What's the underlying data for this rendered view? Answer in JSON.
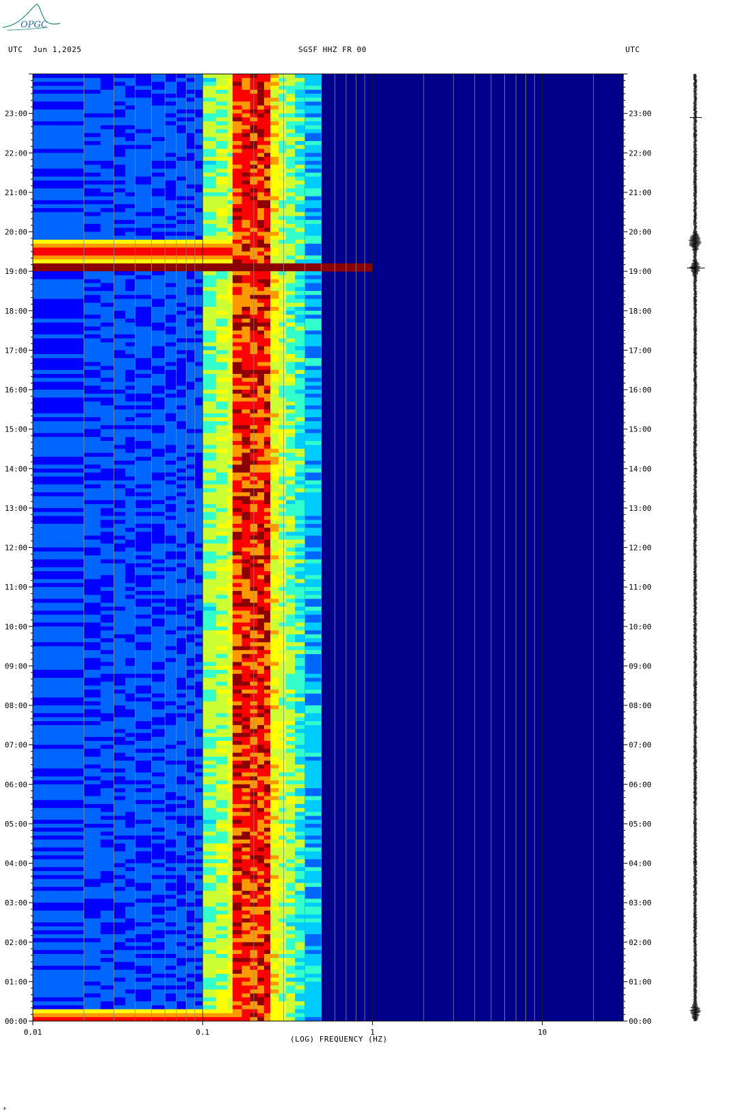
{
  "header": {
    "tz_left": "UTC",
    "date": "Jun 1,2025",
    "station": "SGSF HHZ FR 00",
    "tz_right": "UTC"
  },
  "logo": {
    "text": "OPGC",
    "color": "#1f8f6a"
  },
  "footer_mark": "*",
  "chart_data": {
    "type": "heatmap",
    "title": "SGSF HHZ FR 00",
    "xlabel": "(LOG) FREQUENCY (HZ)",
    "x_scale": "log",
    "xlim": [
      0.01,
      30
    ],
    "x_ticks": [
      0.01,
      0.1,
      1,
      10
    ],
    "x_tick_labels": [
      "0.01",
      "0.1",
      "1",
      "10"
    ],
    "ylim_hours": [
      0,
      24
    ],
    "y_ticks": [
      "00:00",
      "01:00",
      "02:00",
      "03:00",
      "04:00",
      "05:00",
      "06:00",
      "07:00",
      "08:00",
      "09:00",
      "10:00",
      "11:00",
      "12:00",
      "13:00",
      "14:00",
      "15:00",
      "16:00",
      "17:00",
      "18:00",
      "19:00",
      "20:00",
      "21:00",
      "22:00",
      "23:00"
    ],
    "colormap": [
      "#00008b",
      "#0000ff",
      "#0066ff",
      "#00ccff",
      "#33ffcc",
      "#ccff33",
      "#ffff00",
      "#ff9900",
      "#ff0000",
      "#8b0000"
    ],
    "microseism_band_hz": [
      0.15,
      0.25
    ],
    "events": [
      {
        "time": "00:00",
        "description": "strong low-frequency energy"
      },
      {
        "time": "19:05",
        "description": "broadband event up to ~1 Hz"
      },
      {
        "time": "19:30",
        "description": "strong low-frequency energy"
      }
    ],
    "seismogram": {
      "bursts_utc": [
        "00:15",
        "19:05",
        "19:45"
      ]
    }
  }
}
